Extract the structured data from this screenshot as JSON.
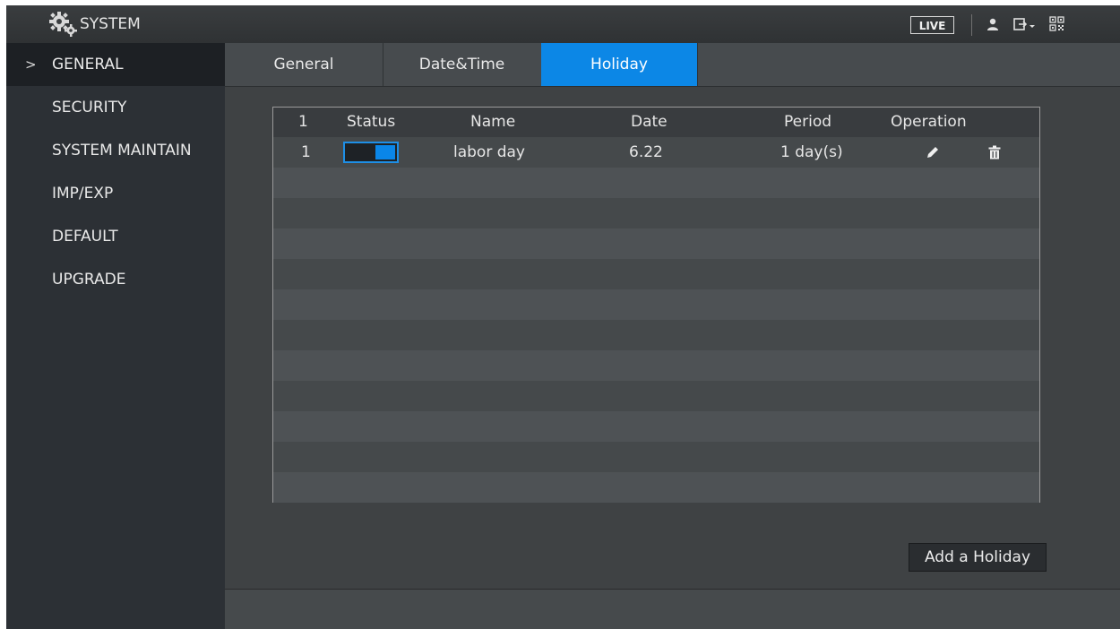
{
  "app": {
    "title": "SYSTEM",
    "icons": [
      "gear-icon",
      "user-icon",
      "logout-icon",
      "qr-icon"
    ],
    "live_label": "LIVE"
  },
  "sidebar": {
    "items": [
      {
        "label": "GENERAL",
        "active": true
      },
      {
        "label": "SECURITY",
        "active": false
      },
      {
        "label": "SYSTEM MAINTAIN",
        "active": false
      },
      {
        "label": "IMP/EXP",
        "active": false
      },
      {
        "label": "DEFAULT",
        "active": false
      },
      {
        "label": "UPGRADE",
        "active": false
      }
    ],
    "active_marker": ">"
  },
  "tabs": [
    {
      "label": "General",
      "selected": false
    },
    {
      "label": "Date&Time",
      "selected": false
    },
    {
      "label": "Holiday",
      "selected": true
    }
  ],
  "table": {
    "headers": {
      "index": "1",
      "status": "Status",
      "name": "Name",
      "date": "Date",
      "period": "Period",
      "operation": "Operation"
    },
    "rows": [
      {
        "index": "1",
        "status_enabled": true,
        "name": "labor day",
        "date": "6.22",
        "period": "1 day(s)"
      }
    ]
  },
  "actions": {
    "add_holiday": "Add a Holiday"
  },
  "colors": {
    "accent": "#0c87e6",
    "background": "#3f4244",
    "sidebar": "#2c3035"
  }
}
